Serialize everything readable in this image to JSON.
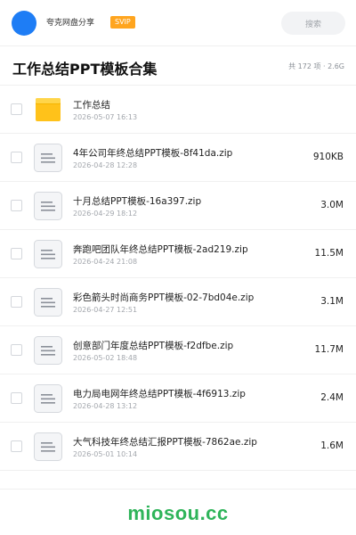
{
  "header": {
    "brand": "夸克网盘分享",
    "badge": "SVIP",
    "search_label": "搜索"
  },
  "folder": {
    "title": "工作总结PPT模板合集",
    "summary": "共 172 项 · 2.6G"
  },
  "files": [
    {
      "name": "工作总结",
      "date": "2026-05-07 16:13",
      "size": "",
      "icon": "folder-icon"
    },
    {
      "name": "4年公司年终总结PPT模板-8f41da.zip",
      "date": "2026-04-28 12:28",
      "size": "910KB",
      "icon": "file-icon"
    },
    {
      "name": "十月总结PPT模板-16a397.zip",
      "date": "2026-04-29 18:12",
      "size": "3.0M",
      "icon": "file-icon"
    },
    {
      "name": "奔跑吧团队年终总结PPT模板-2ad219.zip",
      "date": "2026-04-24 21:08",
      "size": "11.5M",
      "icon": "file-icon"
    },
    {
      "name": "彩色箭头时尚商务PPT模板-02-7bd04e.zip",
      "date": "2026-04-27 12:51",
      "size": "3.1M",
      "icon": "file-icon"
    },
    {
      "name": "创意部门年度总结PPT模板-f2dfbe.zip",
      "date": "2026-05-02 18:48",
      "size": "11.7M",
      "icon": "file-icon"
    },
    {
      "name": "电力局电网年终总结PPT模板-4f6913.zip",
      "date": "2026-04-28 13:12",
      "size": "2.4M",
      "icon": "file-icon"
    },
    {
      "name": "大气科技年终总结汇报PPT模板-7862ae.zip",
      "date": "2026-05-01 10:14",
      "size": "1.6M",
      "icon": "file-icon"
    }
  ],
  "footer": {
    "watermark": "miosou.cc"
  },
  "colors": {
    "avatar": "#1e7df5",
    "svip_badge": "#ffa51f",
    "folder_icon": "#ffc21a",
    "watermark": "#2fb45a"
  }
}
